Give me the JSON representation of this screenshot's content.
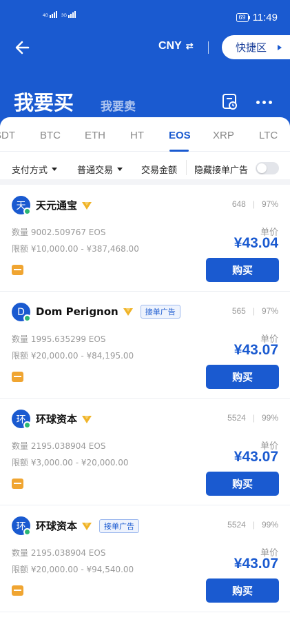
{
  "status_bar": {
    "signal1": "4G",
    "signal2": "3G",
    "battery": "69",
    "time": "11:49"
  },
  "nav": {
    "currency": "CNY",
    "currency_switch_glyph": "⇄",
    "quick_zone": "快捷区"
  },
  "header": {
    "buy_title": "我要买",
    "sell_title": "我要卖"
  },
  "coin_tabs": [
    "SDT",
    "BTC",
    "ETH",
    "HT",
    "EOS",
    "XRP",
    "LTC"
  ],
  "active_coin": "EOS",
  "filters": {
    "payment": "支付方式",
    "trade_type": "普通交易",
    "amount": "交易金额",
    "hide_ads": "隐藏接单广告"
  },
  "offers": [
    {
      "avatar": "天",
      "name": "天元通宝",
      "ad_badge": "",
      "orders": "648",
      "completion": "97%",
      "quantity": "数量 9002.509767 EOS",
      "limit": "限额 ¥10,000.00 - ¥387,468.00",
      "price_label": "单价",
      "price": "¥43.04",
      "buy": "购买"
    },
    {
      "avatar": "D",
      "name": "Dom Perignon",
      "ad_badge": "接单广告",
      "orders": "565",
      "completion": "97%",
      "quantity": "数量 1995.635299 EOS",
      "limit": "限额 ¥20,000.00 - ¥84,195.00",
      "price_label": "单价",
      "price": "¥43.07",
      "buy": "购买"
    },
    {
      "avatar": "环",
      "name": "环球资本",
      "ad_badge": "",
      "orders": "5524",
      "completion": "99%",
      "quantity": "数量 2195.038904 EOS",
      "limit": "限额 ¥3,000.00 - ¥20,000.00",
      "price_label": "单价",
      "price": "¥43.07",
      "buy": "购买"
    },
    {
      "avatar": "环",
      "name": "环球资本",
      "ad_badge": "接单广告",
      "orders": "5524",
      "completion": "99%",
      "quantity": "数量 2195.038904 EOS",
      "limit": "限额 ¥20,000.00 - ¥94,540.00",
      "price_label": "单价",
      "price": "¥43.07",
      "buy": "购买"
    }
  ],
  "colors": {
    "primary": "#1a5ad0",
    "online": "#2bb673",
    "payment_icon": "#f0a531"
  }
}
